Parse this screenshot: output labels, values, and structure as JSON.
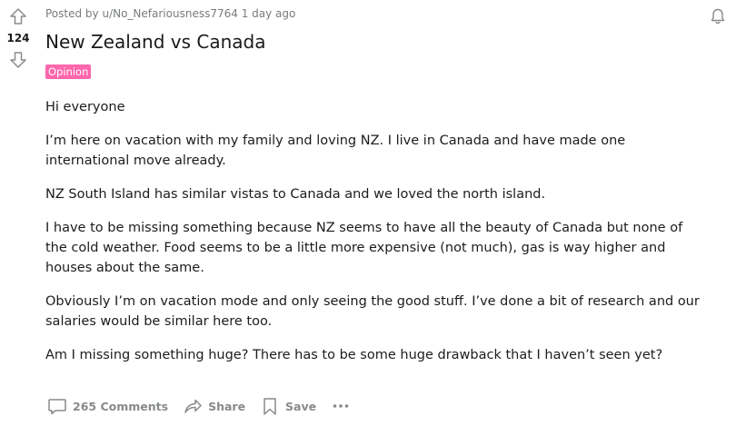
{
  "vote": {
    "count": "124"
  },
  "post": {
    "meta_prefix": "Posted by",
    "author": "u/No_Nefariousness7764",
    "time": "1 day ago",
    "title": "New Zealand vs Canada",
    "flair": "Opinion",
    "body": [
      "Hi everyone",
      "I’m here on vacation with my family and loving NZ. I live in Canada and have made one international move already.",
      "NZ South Island has similar vistas to Canada and we loved the north island.",
      "I have to be missing something because NZ seems to have all the beauty of Canada but none of the cold weather. Food seems to be a little more expensive (not much), gas is way higher and houses about the same.",
      "Obviously I’m on vacation mode and only seeing the good stuff. I’ve done a bit of research and our salaries would be similar here too.",
      "Am I missing something huge? There has to be some huge drawback that I haven’t seen yet?"
    ]
  },
  "actions": {
    "comments_label": "265 Comments",
    "share_label": "Share",
    "save_label": "Save"
  },
  "icons": {
    "upvote": "upvote-arrow-icon",
    "downvote": "downvote-arrow-icon",
    "bell": "bell-icon",
    "comment": "comment-bubble-icon",
    "share": "share-arrow-icon",
    "save": "bookmark-icon",
    "more": "more-dots-icon"
  },
  "colors": {
    "flair_bg": "#ff66ac",
    "meta_text": "#787c7e",
    "action_text": "#878a8c"
  }
}
